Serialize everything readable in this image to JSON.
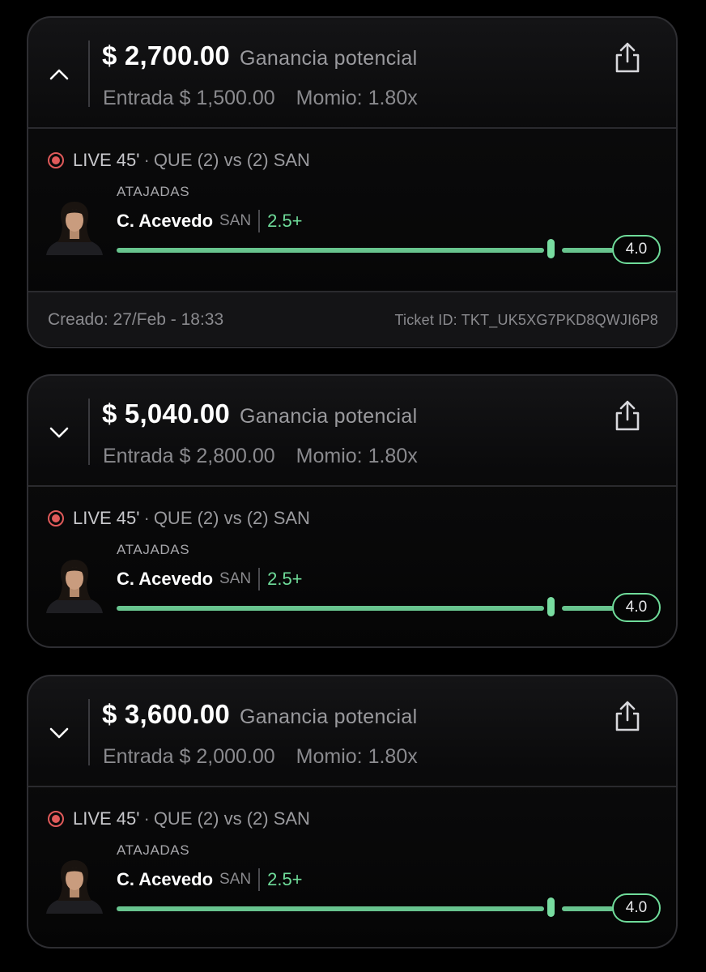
{
  "tickets": [
    {
      "amount": "$ 2,700.00",
      "amount_label": "Ganancia potencial",
      "entry": "Entrada $ 1,500.00",
      "momio": "Momio: 1.80x",
      "chevron": "chevron-up-icon",
      "live": "LIVE 45'",
      "separator": "·",
      "match": "QUE (2) vs (2) SAN",
      "stat": "ATAJADAS",
      "player": "C. Acevedo",
      "team": "SAN",
      "line": "2.5+",
      "value": "4.0",
      "created": "Creado: 27/Feb - 18:33",
      "ticket_id": "Ticket ID: TKT_UK5XG7PKD8QWJI6P8"
    },
    {
      "amount": "$ 5,040.00",
      "amount_label": "Ganancia potencial",
      "entry": "Entrada $ 2,800.00",
      "momio": "Momio: 1.80x",
      "chevron": "chevron-down-icon",
      "live": "LIVE 45'",
      "separator": "·",
      "match": "QUE (2) vs (2) SAN",
      "stat": "ATAJADAS",
      "player": "C. Acevedo",
      "team": "SAN",
      "line": "2.5+",
      "value": "4.0"
    },
    {
      "amount": "$ 3,600.00",
      "amount_label": "Ganancia potencial",
      "entry": "Entrada $ 2,000.00",
      "momio": "Momio: 1.80x",
      "chevron": "chevron-down-icon",
      "live": "LIVE 45'",
      "separator": "·",
      "match": "QUE (2) vs (2) SAN",
      "stat": "ATAJADAS",
      "player": "C. Acevedo",
      "team": "SAN",
      "line": "2.5+",
      "value": "4.0"
    }
  ],
  "colors": {
    "accent": "#6fdc9a",
    "live": "#e05a5a",
    "background": "#000000"
  },
  "icons": [
    "chevron-up-icon",
    "chevron-down-icon",
    "share-icon",
    "live-indicator-icon"
  ]
}
